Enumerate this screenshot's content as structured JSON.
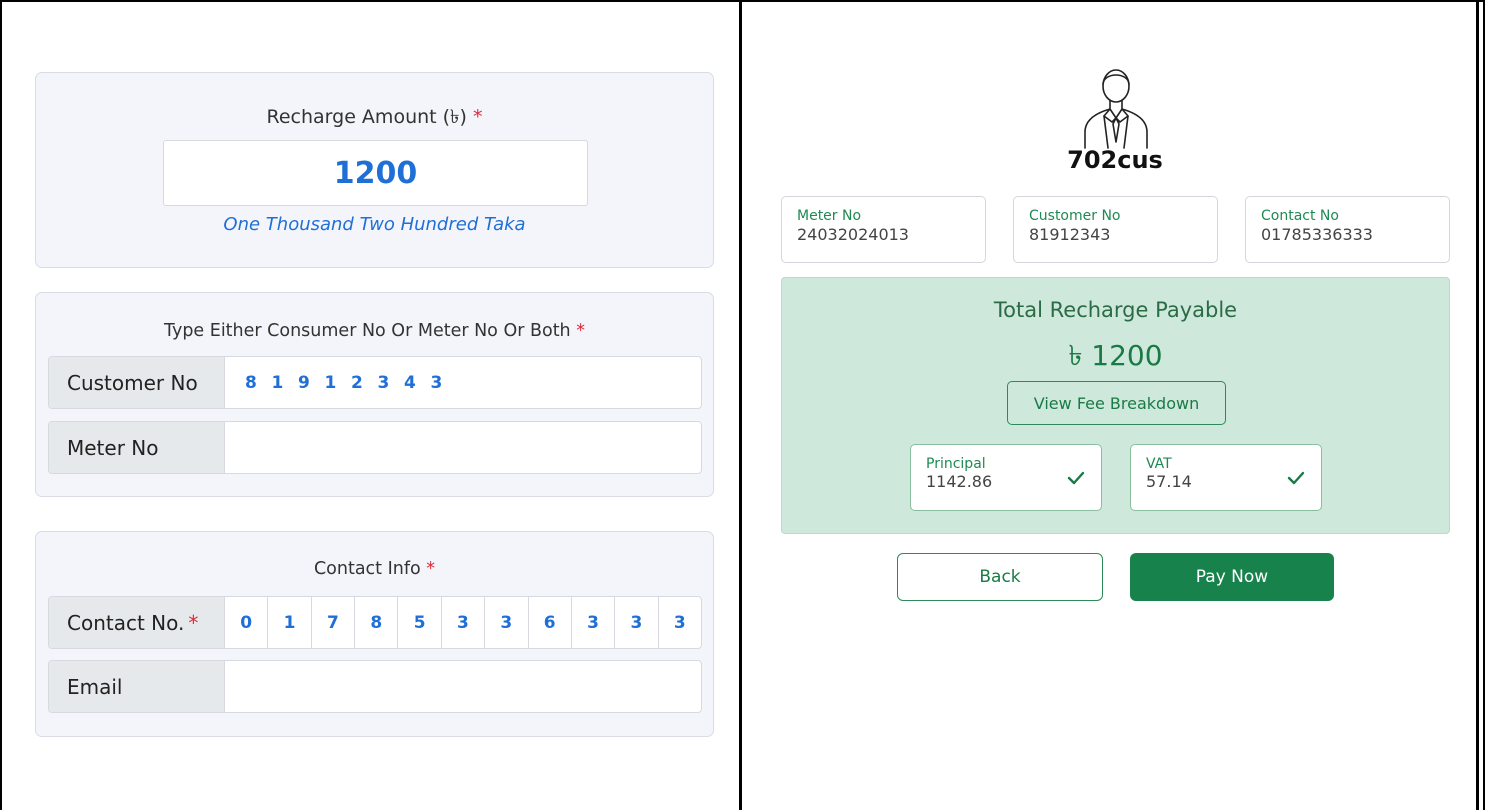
{
  "recharge": {
    "title": "Recharge Amount (৳)",
    "required_mark": "*",
    "amount": "1200",
    "amount_in_words": "One Thousand Two Hundred Taka"
  },
  "consumer": {
    "title": "Type Either Consumer No Or Meter No Or Both",
    "required_mark": "*",
    "customer_label": "Customer No",
    "customer_digits": [
      "8",
      "1",
      "9",
      "1",
      "2",
      "3",
      "4",
      "3"
    ],
    "meter_label": "Meter No",
    "meter_value": ""
  },
  "contact": {
    "title": "Contact Info",
    "required_mark": "*",
    "contact_label": "Contact No.",
    "contact_digits": [
      "0",
      "1",
      "7",
      "8",
      "5",
      "3",
      "3",
      "6",
      "3",
      "3",
      "3"
    ],
    "email_label": "Email",
    "email_value": ""
  },
  "profile": {
    "avatar_icon": "businessman-avatar-icon",
    "username": "702cus",
    "meter_no_label": "Meter No",
    "meter_no_value": "24032024013",
    "customer_no_label": "Customer No",
    "customer_no_value": "81912343",
    "contact_no_label": "Contact No",
    "contact_no_value": "01785336333"
  },
  "payable": {
    "title": "Total Recharge Payable",
    "amount": "৳ 1200",
    "fee_button": "View Fee Breakdown",
    "principal_label": "Principal",
    "principal_value": "1142.86",
    "vat_label": "VAT",
    "vat_value": "57.14",
    "check_icon": "check-icon"
  },
  "actions": {
    "back_label": "Back",
    "pay_label": "Pay Now"
  },
  "colors": {
    "accent_blue": "#1f6fd6",
    "accent_green": "#17824b",
    "panel_green": "#cfe8dc",
    "required_red": "#e0283a"
  }
}
